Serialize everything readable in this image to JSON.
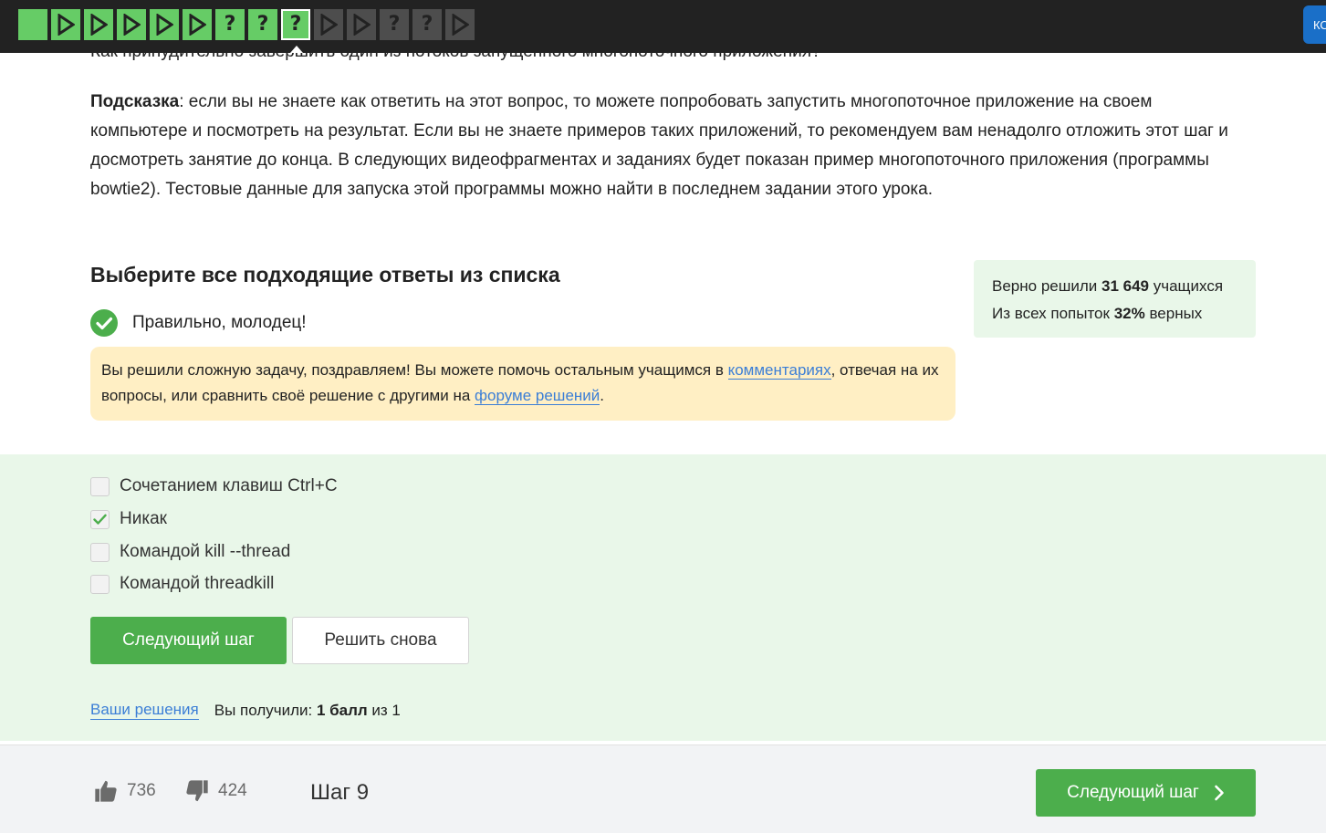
{
  "topbar": {
    "steps": [
      {
        "kind": "done",
        "icon": "square"
      },
      {
        "kind": "done",
        "icon": "play"
      },
      {
        "kind": "done",
        "icon": "play"
      },
      {
        "kind": "done",
        "icon": "play"
      },
      {
        "kind": "done",
        "icon": "play"
      },
      {
        "kind": "done",
        "icon": "play"
      },
      {
        "kind": "done",
        "icon": "question"
      },
      {
        "kind": "done",
        "icon": "question"
      },
      {
        "kind": "current",
        "icon": "question"
      },
      {
        "kind": "todo",
        "icon": "play"
      },
      {
        "kind": "todo",
        "icon": "play"
      },
      {
        "kind": "todo",
        "icon": "question"
      },
      {
        "kind": "todo",
        "icon": "question"
      },
      {
        "kind": "todo",
        "icon": "play"
      }
    ],
    "corner_button_label": "КО"
  },
  "question_text": "Как принудительно завершить один из потоков запущенного многопоточного приложения?",
  "hint": {
    "label": "Подсказка",
    "text": ": если вы не знаете как ответить на этот вопрос, то можете попробовать запустить многопоточное приложение на своем компьютере и посмотреть на результат. Если вы не знаете примеров таких приложений, то рекомендуем вам ненадолго отложить этот шаг и досмотреть занятие до конца. В следующих видеофрагментах и заданиях будет показан пример многопоточного приложения (программы bowtie2). Тестовые данные для запуска этой программы можно найти в последнем задании этого урока."
  },
  "quiz": {
    "title": "Выберите все подходящие ответы из списка",
    "feedback": "Правильно, молодец!",
    "congrats": {
      "text_before": "Вы решили сложную задачу, поздравляем! Вы можете помочь остальным учащимся в ",
      "link_comments": "комментариях",
      "text_middle": ", отвечая на их вопросы, или сравнить своё решение с другими на ",
      "link_forum": "форуме решений",
      "text_after": "."
    },
    "options": [
      {
        "label": "Сочетанием клавиш Ctrl+C",
        "checked": false
      },
      {
        "label": "Никак",
        "checked": true
      },
      {
        "label": "Командой kill --thread",
        "checked": false
      },
      {
        "label": "Командой threadkill",
        "checked": false
      }
    ],
    "next_button": "Следующий шаг",
    "retry_button": "Решить снова",
    "solutions_link": "Ваши решения",
    "score_prefix": "Вы получили: ",
    "score_bold": "1 балл",
    "score_suffix": " из 1"
  },
  "stats": {
    "line1_prefix": "Верно решили ",
    "line1_count": "31 649",
    "line1_suffix": " учащихся",
    "line2_prefix": "Из всех попыток ",
    "line2_percent": "32%",
    "line2_suffix": " верных"
  },
  "footer": {
    "likes": "736",
    "dislikes": "424",
    "step_label": "Шаг 9",
    "next_button": "Следующий шаг"
  },
  "colors": {
    "accent_green": "#4cae4c",
    "step_done": "#66cc66",
    "step_todo": "#4d4d4d",
    "topbar_bg": "#222222",
    "link_blue": "#3b7ed6",
    "congrats_bg": "#ffefc4",
    "answers_bg": "#e9f7e9"
  }
}
